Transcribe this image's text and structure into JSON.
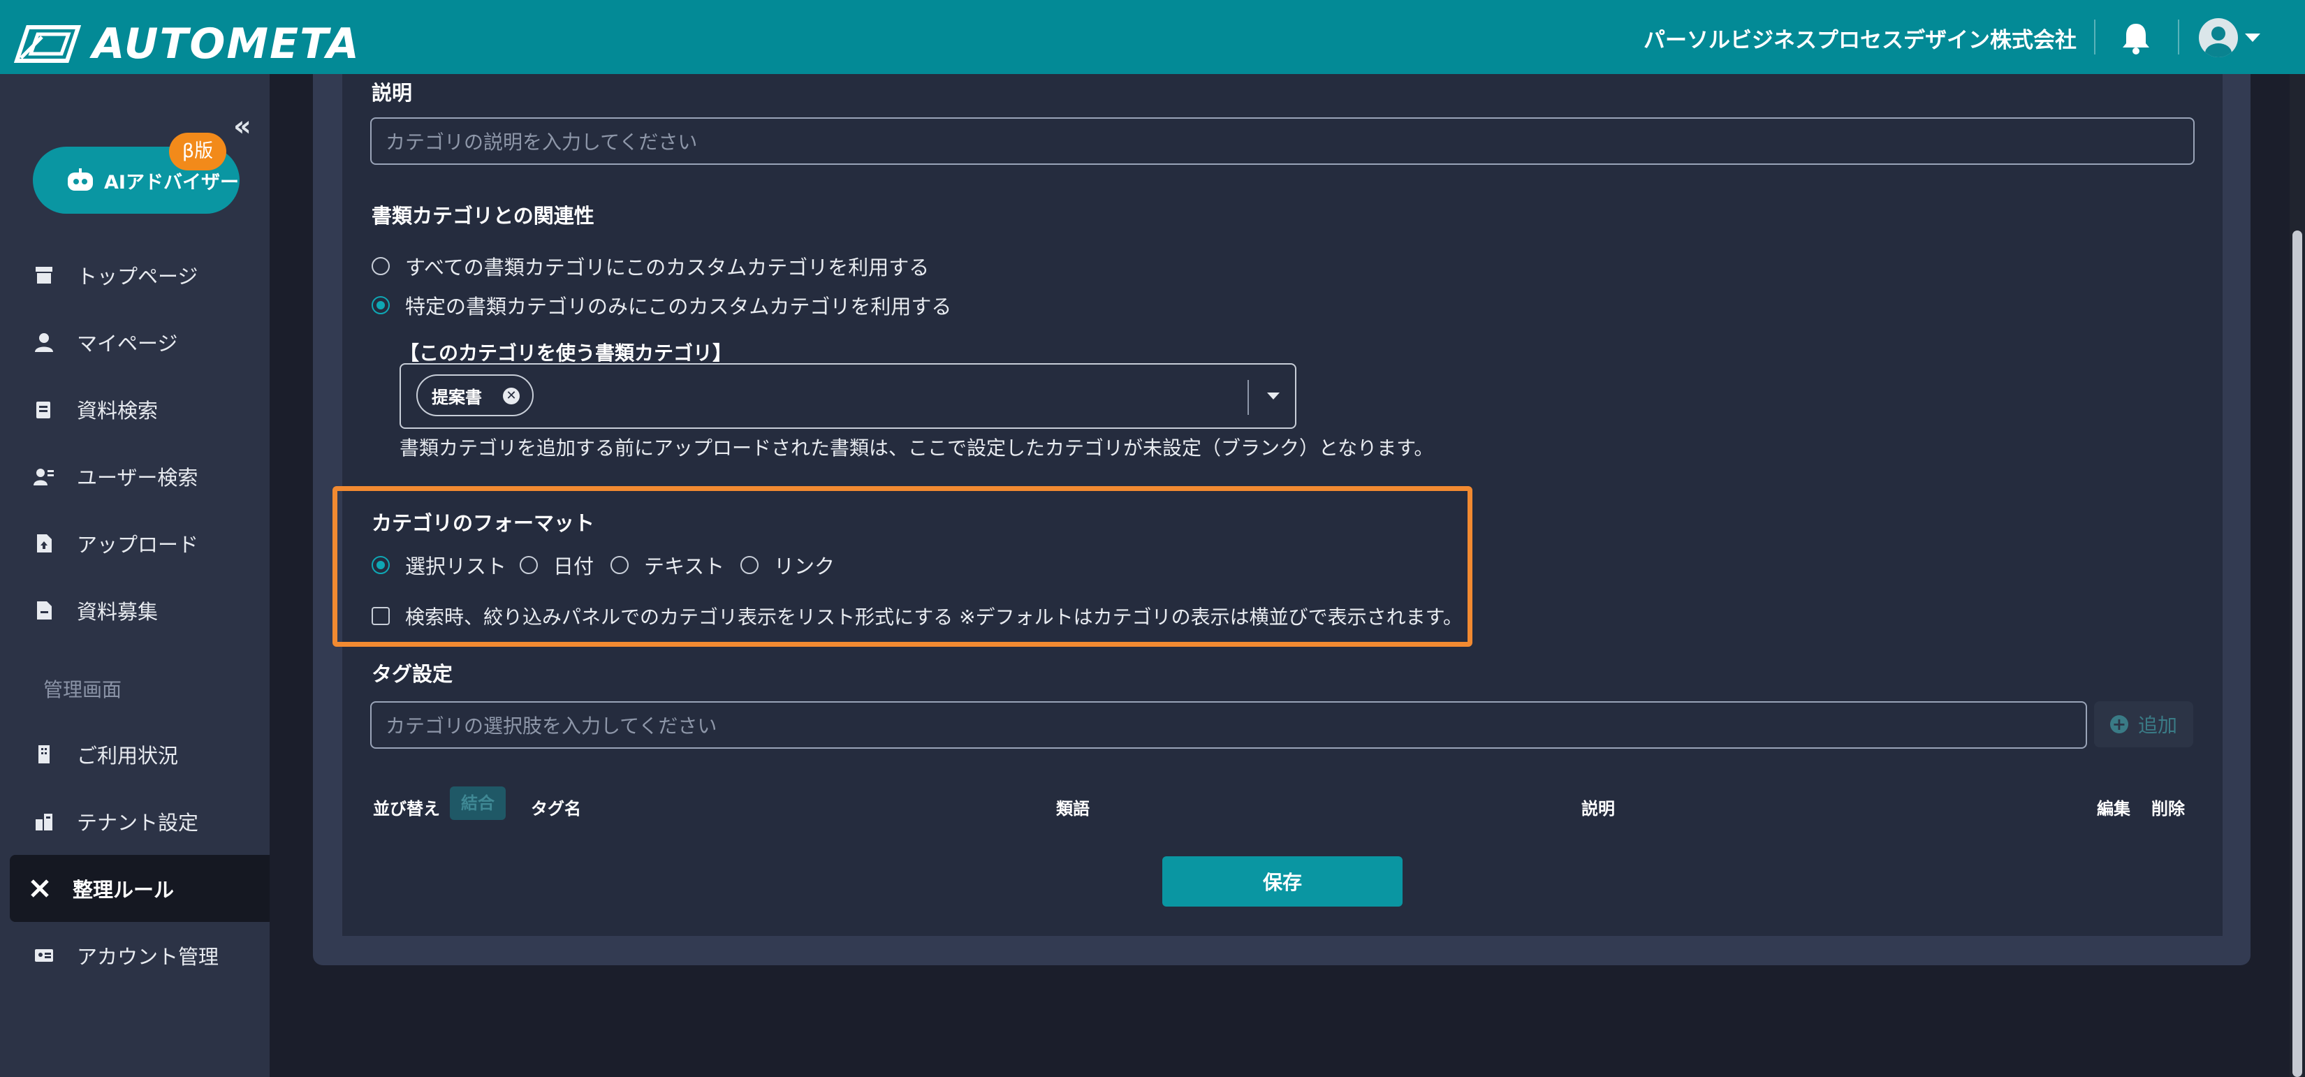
{
  "header": {
    "brand": "AUTOMETA",
    "company": "パーソルビジネスプロセスデザイン株式会社",
    "bell_icon": "bell-icon",
    "user_icon": "user-avatar-icon"
  },
  "sidebar": {
    "collapse_glyph": "«",
    "ai_button": {
      "label": "AIアドバイザー",
      "badge": "β版"
    },
    "items": [
      {
        "label": "トップページ",
        "icon": "store-icon"
      },
      {
        "label": "マイページ",
        "icon": "person-icon"
      },
      {
        "label": "資料検索",
        "icon": "documents-icon"
      },
      {
        "label": "ユーザー検索",
        "icon": "user-search-icon"
      },
      {
        "label": "アップロード",
        "icon": "file-upload-icon"
      },
      {
        "label": "資料募集",
        "icon": "file-icon"
      }
    ],
    "section_label": "管理画面",
    "admin_items": [
      {
        "label": "ご利用状況",
        "icon": "building-icon"
      },
      {
        "label": "テナント設定",
        "icon": "tenant-icon"
      },
      {
        "label": "整理ルール",
        "icon": "tools-icon",
        "active": true
      },
      {
        "label": "アカウント管理",
        "icon": "id-card-icon"
      }
    ]
  },
  "form": {
    "description_label": "説明",
    "description_placeholder": "カテゴリの説明を入力してください",
    "relation_label": "書類カテゴリとの関連性",
    "relation_options": [
      "すべての書類カテゴリにこのカスタムカテゴリを利用する",
      "特定の書類カテゴリのみにこのカスタムカテゴリを利用する"
    ],
    "relation_selected": 1,
    "doc_category_label": "【このカテゴリを使う書類カテゴリ】",
    "doc_category_chip": "提案書",
    "doc_category_note": "書類カテゴリを追加する前にアップロードされた書類は、ここで設定したカテゴリが未設定（ブランク）となります。",
    "format_label": "カテゴリのフォーマット",
    "format_options": [
      "選択リスト",
      "日付",
      "テキスト",
      "リンク"
    ],
    "format_selected": 0,
    "list_display_checkbox": "検索時、絞り込みパネルでのカテゴリ表示をリスト形式にする ※デフォルトはカテゴリの表示は横並びで表示されます。",
    "list_display_checked": false,
    "tag_label": "タグ設定",
    "tag_placeholder": "カテゴリの選択肢を入力してください",
    "add_button": "追加",
    "table_headers": {
      "sort": "並び替え",
      "combine": "結合",
      "tag_name": "タグ名",
      "synonym": "類語",
      "description": "説明",
      "edit": "編集",
      "delete": "削除"
    },
    "save_button": "保存"
  },
  "colors": {
    "header_bg": "#038a96",
    "accent": "#0a96a2",
    "highlight": "#f28a31",
    "sidebar_bg": "#2c3346"
  }
}
